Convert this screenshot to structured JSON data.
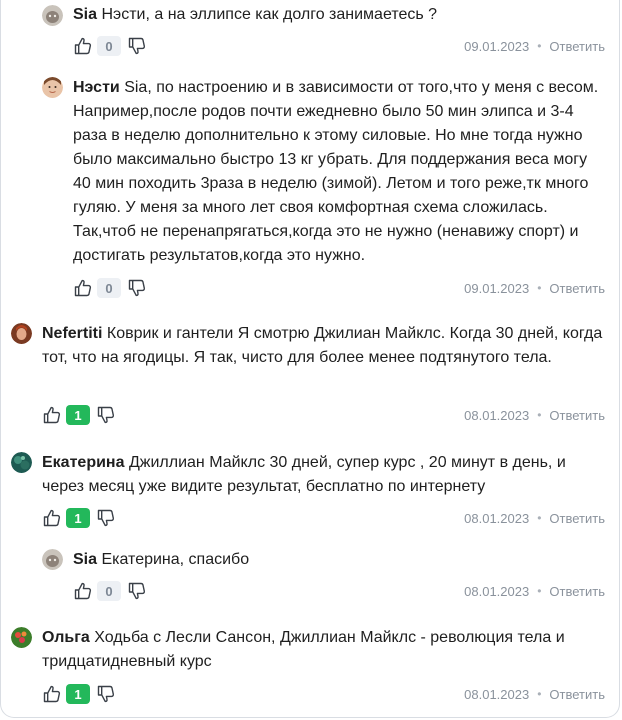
{
  "comments": [
    {
      "author": "Sia",
      "text": "Нэсти, а на эллипсе как долго занимаетесь ?",
      "votes": "0",
      "date": "09.01.2023",
      "reply": "Ответить"
    },
    {
      "author": "Нэсти",
      "text": "Sia, по настроению и в зависимости от того,что у меня с весом. Например,после родов почти ежедневно было 50 мин элипса и 3-4 раза в неделю дополнительно к этому силовые. Но мне тогда нужно было максимально быстро 13 кг убрать. Для поддержания веса могу 40 мин походить 3раза в неделю (зимой). Летом и того реже,тк много гуляю. У меня за много лет своя комфортная схема сложилась. Так,чтоб не перенапрягаться,когда это не нужно (ненавижу спорт) и достигать результатов,когда это нужно.",
      "votes": "0",
      "date": "09.01.2023",
      "reply": "Ответить"
    },
    {
      "author": "Nefertiti",
      "text": "Коврик и гантели Я смотрю Джилиан Майклс. Когда 30 дней, когда тот, что на ягодицы. Я так, чисто для более менее подтянутого тела.",
      "votes": "1",
      "date": "08.01.2023",
      "reply": "Ответить"
    },
    {
      "author": "Екатерина",
      "text": "Джиллиан Майклс 30 дней, супер курс , 20 минут в день, и через месяц уже видите результат, бесплатно по интернету",
      "votes": "1",
      "date": "08.01.2023",
      "reply": "Ответить"
    },
    {
      "author": "Sia",
      "text": "Екатерина, спасибо",
      "votes": "0",
      "date": "08.01.2023",
      "reply": "Ответить"
    },
    {
      "author": "Ольга",
      "text": "Ходьба с Лесли Сансон, Джиллиан Майклс - революция тела и тридцатидневный курс",
      "votes": "1",
      "date": "08.01.2023",
      "reply": "Ответить"
    }
  ],
  "colors": {
    "positive": "#23b85b",
    "neutral_bg": "#edf0f4",
    "muted": "#8a929c"
  },
  "icons": {
    "like": "thumbs-up-icon",
    "dislike": "thumbs-down-icon"
  }
}
